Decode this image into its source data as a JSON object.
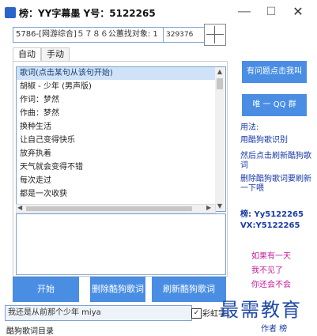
{
  "window": {
    "title": "榜：YY字幕墨  Y号：5122265",
    "min_label": "—",
    "max_label": "☐",
    "close_label": "✕"
  },
  "top_inputs": {
    "song_info": "5786-[网游综合]５７８６公蕙找对象: 1",
    "qq_value": "329376"
  },
  "tabs": [
    {
      "label": "自动"
    },
    {
      "label": "手动"
    }
  ],
  "lyrics": {
    "header": "歌词(点击某句从该句开始)",
    "lines": [
      "胡椒 - 少年 (男声版)",
      "作词：梦然",
      "作曲：梦然",
      "换种生活",
      "让自己变得快乐",
      "放弃执着",
      "天气就会变得不错",
      "每次走过",
      "都是一次收获"
    ]
  },
  "buttons": {
    "start": "开始",
    "delete_kugou": "删除酷狗歌词",
    "refresh_kugou": "刷新酷狗歌词"
  },
  "status": {
    "current_song": "我还是从前那个少年 miya",
    "color_checkbox_label": "彩虹字",
    "lyric_dir_label": "酷狗歌词目录"
  },
  "sidebar": {
    "problem_button": "有问题点击我叫",
    "qq_group_button": "唯 一 QQ 群",
    "usage_title": "用法:",
    "usage_1": "用酷狗歌识别",
    "usage_2": "然后点击刷新酷狗歌词",
    "usage_3": "删除酷狗歌词要刷新一下喂",
    "contact_wechat": "榜: Yy5122265",
    "contact_vx": "VX:Y5122265",
    "poem_1": "如果有一天",
    "poem_2": "我不见了",
    "poem_3": "你还会不会",
    "author": "作者 榜"
  },
  "watermark": "最需教育",
  "colors": {
    "accent_blue": "#4a8ee4",
    "sidebar_text": "#1a3aa8",
    "poem_text": "#c0209a",
    "watermark": "#1f49a8"
  }
}
